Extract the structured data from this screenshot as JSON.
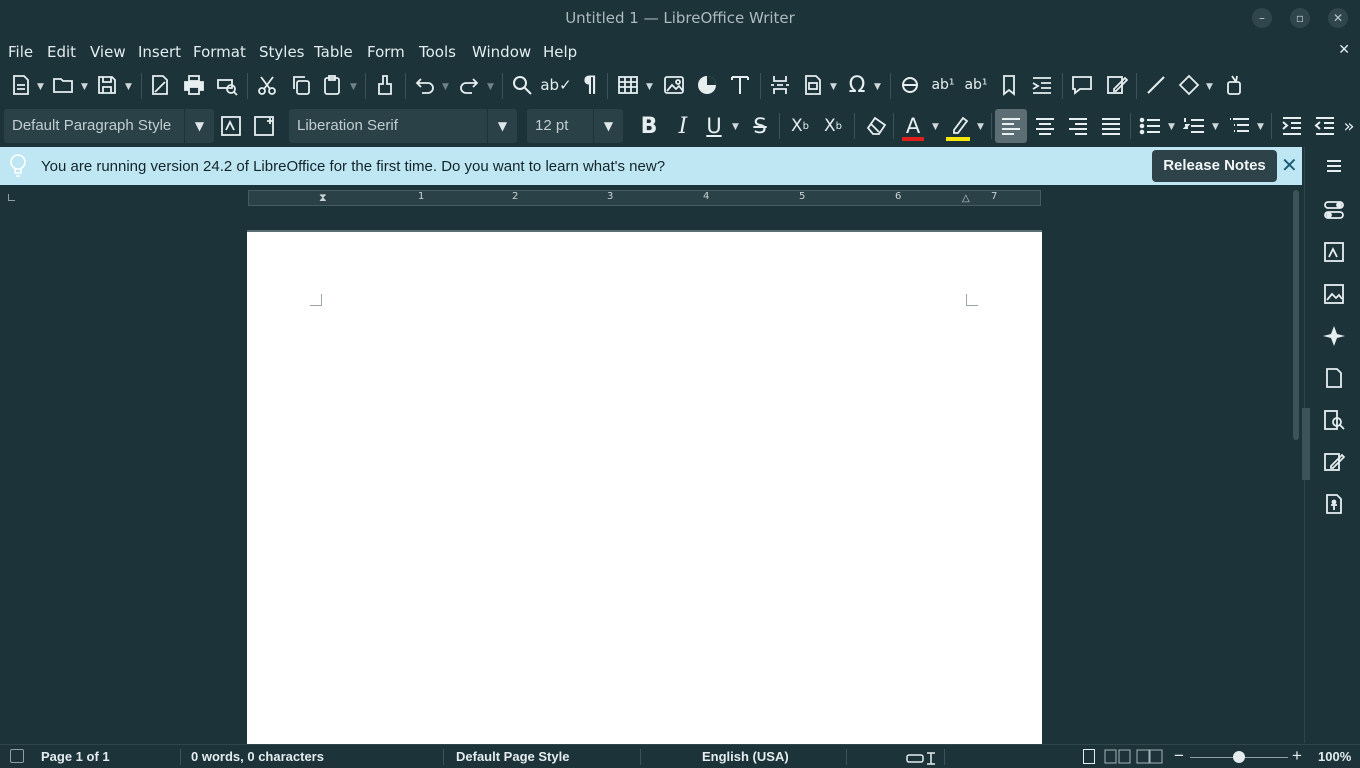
{
  "window": {
    "title": "Untitled 1 — LibreOffice Writer",
    "minimize_glyph": "–",
    "maximize_glyph": "▫",
    "close_glyph": "✕"
  },
  "menu": {
    "items": [
      "File",
      "Edit",
      "View",
      "Insert",
      "Format",
      "Styles",
      "Table",
      "Form",
      "Tools",
      "Window",
      "Help"
    ],
    "close_glyph": "✕"
  },
  "formatting": {
    "paragraph_style": "Default Paragraph Style",
    "font_name": "Liberation Serif",
    "font_size": "12 pt"
  },
  "infobar": {
    "message": "You are running version 24.2 of LibreOffice for the first time. Do you want to learn what's new?",
    "button_label": "Release Notes",
    "close_glyph": "✕"
  },
  "ruler": {
    "numbers": [
      "1",
      "2",
      "3",
      "4",
      "5",
      "6",
      "7"
    ]
  },
  "statusbar": {
    "page": "Page 1 of 1",
    "words": "0 words, 0 characters",
    "page_style": "Default Page Style",
    "language": "English (USA)",
    "zoom": "100%",
    "zoom_minus": "−",
    "zoom_plus": "+"
  },
  "colors": {
    "background": "#1c3339",
    "infobar": "#bee7f3",
    "font_color_accent": "#e0201c",
    "highlight_accent": "#f5e60c"
  }
}
